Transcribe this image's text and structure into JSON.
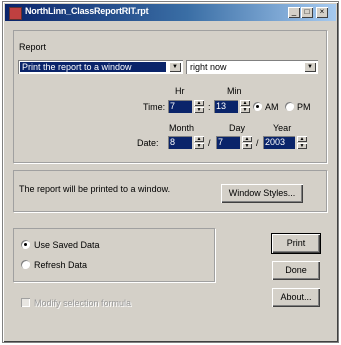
{
  "window": {
    "title": "NorthLinn_ClassReportRIT.rpt",
    "minimize_glyph": "_",
    "maximize_glyph": "□",
    "close_glyph": "×"
  },
  "report": {
    "group_label": "Report",
    "destination": "Print the report to a window",
    "when": "right now"
  },
  "time": {
    "label": "Time:",
    "hr_label": "Hr",
    "min_label": "Min",
    "hr_value": "7",
    "min_value": "13",
    "separator": ":",
    "am_label": "AM",
    "pm_label": "PM"
  },
  "date": {
    "label": "Date:",
    "month_label": "Month",
    "day_label": "Day",
    "year_label": "Year",
    "month_value": "8",
    "day_value": "7",
    "year_value": "2003",
    "separator": "/"
  },
  "status": {
    "message": "The report will be printed to a window.",
    "window_styles_label": "Window Styles..."
  },
  "data_options": {
    "use_saved_label": "Use Saved Data",
    "refresh_label": "Refresh Data"
  },
  "buttons": {
    "print": "Print",
    "done": "Done",
    "about": "About..."
  },
  "modify_label": "Modify selection formula"
}
